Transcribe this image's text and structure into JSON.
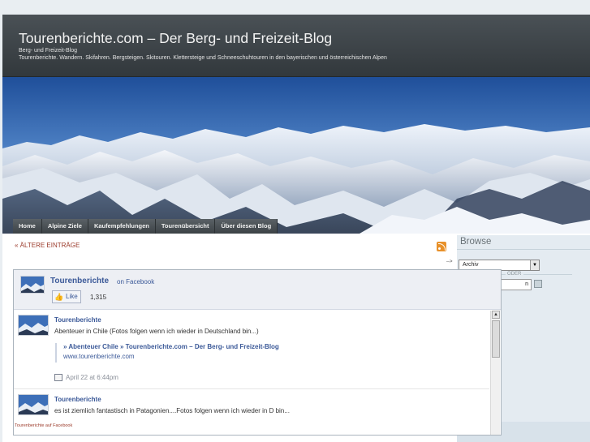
{
  "header": {
    "title": "Tourenberichte.com – Der Berg- und Freizeit-Blog",
    "subtitle": "Berg- und Freizeit-Blog",
    "description": "Tourenberichte. Wandern. Skifahren. Bergsteigen. Skitouren. Klettersteige und Schneeschuhtouren in den bayerischen und österreichischen Alpen"
  },
  "nav": {
    "items": [
      {
        "label": "Home"
      },
      {
        "label": "Alpine Ziele"
      },
      {
        "label": "Kaufempfehlungen"
      },
      {
        "label": "Tourenübersicht"
      },
      {
        "label": "Über diesen Blog"
      }
    ]
  },
  "content": {
    "older_entries": "« ÄLTERE EINTRÄGE",
    "arrow_mark": "-->"
  },
  "sidebar": {
    "title": "Browse",
    "archive_select": "Archiv",
    "or_label": "ODER",
    "search_value": "n"
  },
  "facebook": {
    "page_name": "Tourenberichte",
    "on_label": "on Facebook",
    "like_label": "Like",
    "like_count": "1,315",
    "posts": [
      {
        "author": "Tourenberichte",
        "text": "Abenteuer in Chile (Fotos folgen wenn ich wieder in Deutschland bin...)",
        "link_title": "» Abenteuer Chile » Tourenberichte.com – Der Berg- und Freizeit-Blog",
        "link_url": "www.tourenberichte.com",
        "meta": "April 22 at 6:44pm"
      },
      {
        "author": "Tourenberichte",
        "text": "es ist ziemlich fantastisch in Patagonien....Fotos folgen wenn ich wieder in D bin..."
      }
    ],
    "footer_link": "Tourenberichte auf Facebook"
  },
  "colors": {
    "header_bg": "#3b4246",
    "nav_bg": "#4a5156",
    "facebook_blue": "#3b5998",
    "link_red": "#9b3a2a",
    "rss_orange": "#e8912a"
  }
}
